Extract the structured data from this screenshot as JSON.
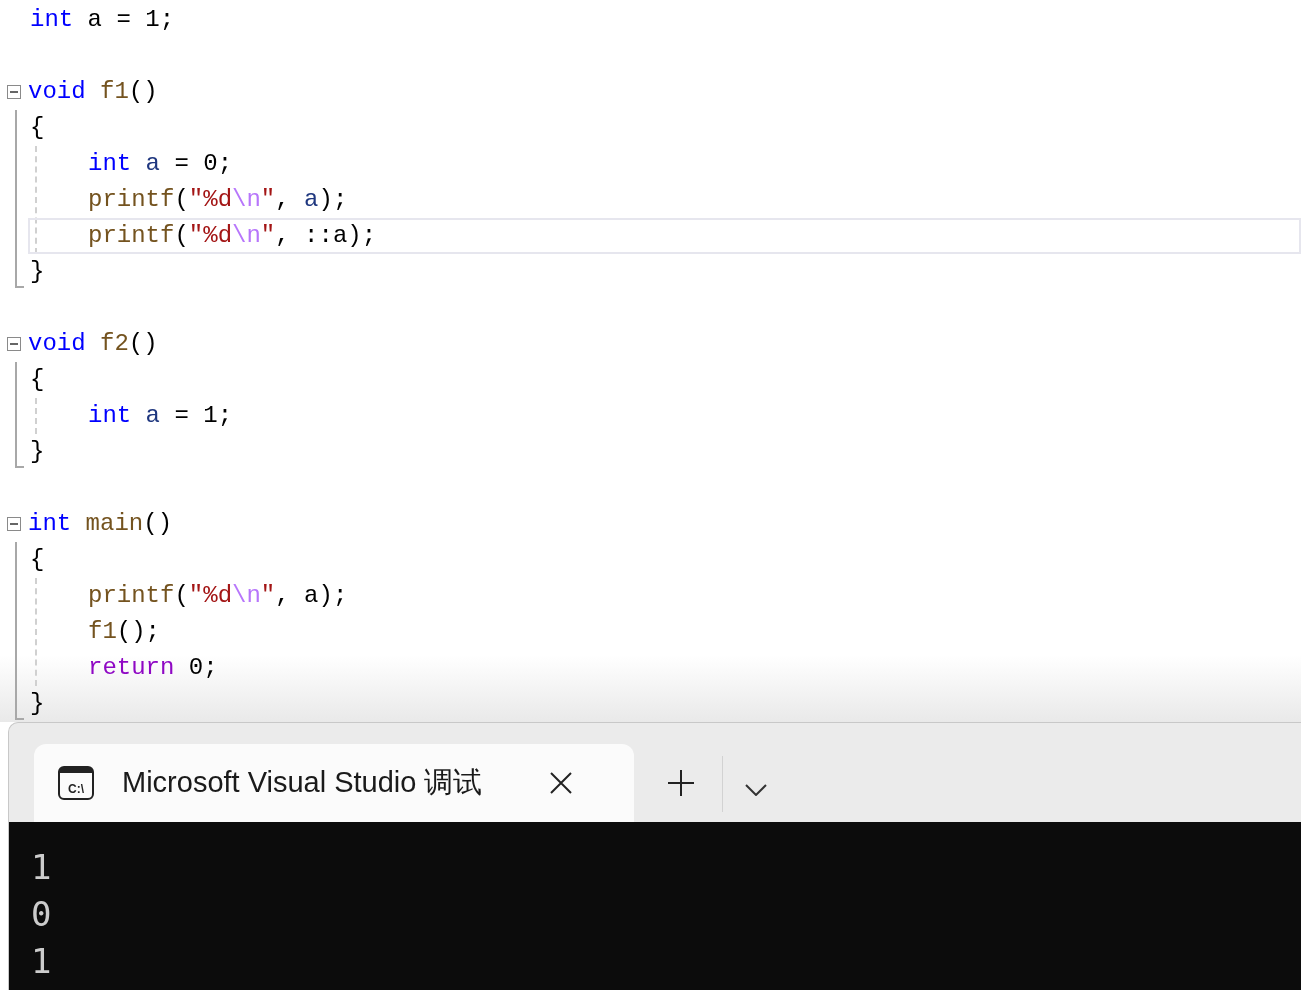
{
  "editor": {
    "items": [
      {
        "kind": "statement",
        "tokens": [
          {
            "kind": "keyword",
            "text": "int"
          },
          {
            "kind": "plain",
            "text": " a = 1;"
          }
        ]
      },
      {
        "kind": "blank"
      },
      {
        "kind": "function",
        "expanded": true,
        "header": [
          {
            "kind": "keyword",
            "text": "void"
          },
          {
            "kind": "function",
            "text": " f1"
          },
          {
            "kind": "plain",
            "text": "()"
          }
        ],
        "open": "{",
        "close": "}",
        "children": [
          {
            "highlighted": false,
            "tokens": [
              {
                "kind": "keyword",
                "text": "int"
              },
              {
                "kind": "local",
                "text": " a"
              },
              {
                "kind": "plain",
                "text": " = 0;"
              }
            ]
          },
          {
            "highlighted": false,
            "tokens": [
              {
                "kind": "function",
                "text": "printf"
              },
              {
                "kind": "plain",
                "text": "("
              },
              {
                "kind": "string",
                "text": "\"%d"
              },
              {
                "kind": "escape",
                "text": "\\n"
              },
              {
                "kind": "string",
                "text": "\""
              },
              {
                "kind": "plain",
                "text": ","
              },
              {
                "kind": "local",
                "text": " a"
              },
              {
                "kind": "plain",
                "text": ");"
              }
            ]
          },
          {
            "highlighted": true,
            "tokens": [
              {
                "kind": "function",
                "text": "printf"
              },
              {
                "kind": "plain",
                "text": "("
              },
              {
                "kind": "string",
                "text": "\"%d"
              },
              {
                "kind": "escape",
                "text": "\\n"
              },
              {
                "kind": "string",
                "text": "\""
              },
              {
                "kind": "plain",
                "text": ", ::a);"
              }
            ]
          }
        ]
      },
      {
        "kind": "blank"
      },
      {
        "kind": "function",
        "expanded": true,
        "header": [
          {
            "kind": "keyword",
            "text": "void"
          },
          {
            "kind": "function",
            "text": " f2"
          },
          {
            "kind": "plain",
            "text": "()"
          }
        ],
        "open": "{",
        "close": "}",
        "children": [
          {
            "highlighted": false,
            "tokens": [
              {
                "kind": "keyword",
                "text": "int"
              },
              {
                "kind": "local",
                "text": " a"
              },
              {
                "kind": "plain",
                "text": " = 1;"
              }
            ]
          }
        ]
      },
      {
        "kind": "blank"
      },
      {
        "kind": "function",
        "expanded": true,
        "header": [
          {
            "kind": "keyword",
            "text": "int"
          },
          {
            "kind": "function",
            "text": " main"
          },
          {
            "kind": "plain",
            "text": "()"
          }
        ],
        "open": "{",
        "close": "}",
        "children": [
          {
            "highlighted": false,
            "tokens": [
              {
                "kind": "function",
                "text": "printf"
              },
              {
                "kind": "plain",
                "text": "("
              },
              {
                "kind": "string",
                "text": "\"%d"
              },
              {
                "kind": "escape",
                "text": "\\n"
              },
              {
                "kind": "string",
                "text": "\""
              },
              {
                "kind": "plain",
                "text": ", a);"
              }
            ]
          },
          {
            "highlighted": false,
            "tokens": [
              {
                "kind": "function",
                "text": "f1"
              },
              {
                "kind": "plain",
                "text": "();"
              }
            ]
          },
          {
            "highlighted": false,
            "tokens": [
              {
                "kind": "control",
                "text": "return"
              },
              {
                "kind": "plain",
                "text": " 0;"
              }
            ]
          }
        ]
      }
    ]
  },
  "terminal": {
    "tab": {
      "selected": true,
      "icon_text": "C:\\",
      "title": "Microsoft Visual Studio 调试"
    },
    "output": [
      "1",
      "0",
      "1"
    ]
  }
}
